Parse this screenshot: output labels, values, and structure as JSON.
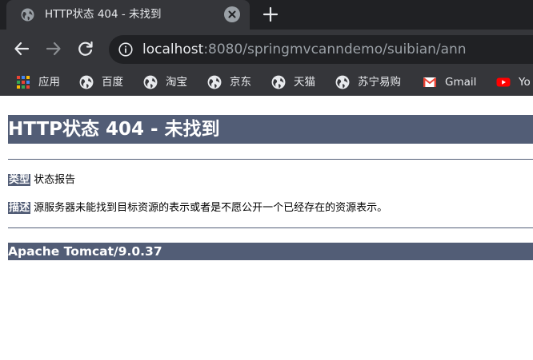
{
  "tab": {
    "title": "HTTP状态 404 - 未找到",
    "favicon_icon": "globe-icon",
    "close_icon": "close-icon"
  },
  "new_tab_icon": "plus-icon",
  "toolbar": {
    "back_icon": "arrow-left-icon",
    "forward_icon": "arrow-right-icon",
    "reload_icon": "reload-icon",
    "info_icon": "info-icon",
    "url_host": "localhost",
    "url_rest": ":8080/springmvcanndemo/suibian/ann"
  },
  "bookmarks": [
    {
      "label": "应用",
      "icon": "apps-grid-icon"
    },
    {
      "label": "百度",
      "icon": "globe-icon"
    },
    {
      "label": "淘宝",
      "icon": "globe-icon"
    },
    {
      "label": "京东",
      "icon": "globe-icon"
    },
    {
      "label": "天猫",
      "icon": "globe-icon"
    },
    {
      "label": "苏宁易购",
      "icon": "globe-icon"
    },
    {
      "label": "Gmail",
      "icon": "gmail-icon"
    },
    {
      "label": "Yo",
      "icon": "youtube-icon"
    }
  ],
  "page": {
    "heading": "HTTP状态 404 - 未找到",
    "type_label": "类型",
    "type_value": "状态报告",
    "desc_label": "描述",
    "desc_value": "源服务器未能找到目标资源的表示或者是不愿公开一个已经存在的资源表示。",
    "server_info": "Apache Tomcat/9.0.37"
  },
  "colors": {
    "chrome_dark": "#202124",
    "chrome_bar": "#35363a",
    "tomcat_header": "#525d76"
  }
}
